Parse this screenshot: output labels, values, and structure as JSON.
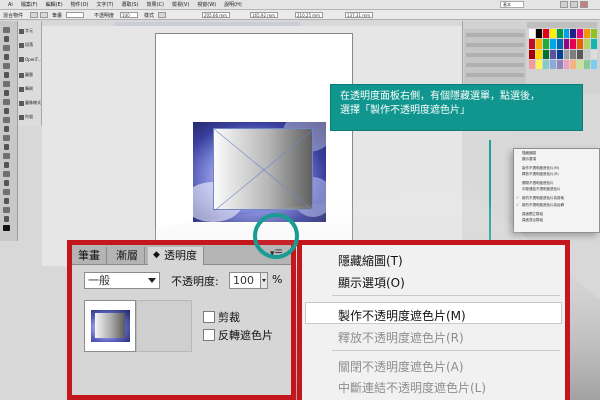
{
  "menubar": {
    "items": [
      "Ai",
      "檔案(F)",
      "編輯(E)",
      "物件(O)",
      "文字(T)",
      "選取(S)",
      "效果(C)",
      "檢視(V)",
      "視窗(W)",
      "說明(H)"
    ],
    "workspace": "基本"
  },
  "ctrlbar": {
    "selection_label": "混合物件",
    "stroke_label": "筆畫",
    "opacity_label": "不透明度",
    "opacity_value": "100",
    "style_label": "樣式",
    "x_value": "205.66 mm",
    "y_value": "165.92 mm",
    "w_value": "210.25 mm",
    "h_value": "137.31 mm"
  },
  "left_panel": {
    "items": [
      "字元",
      "段落",
      "OpenT...",
      "圖層",
      "筆刷",
      "圖像樣式",
      "符號"
    ]
  },
  "callout": {
    "line1": "在透明度面板右側，有個隱藏選單，點選後，",
    "line2": "選擇「製作不透明度遮色片」"
  },
  "mini_menu": {
    "items": [
      "隱藏縮圖",
      "顯示選項",
      "製作不透明度遮色片(M)",
      "釋放不透明度遮色片(R)",
      "關閉不透明度遮色片",
      "中斷連結不透明度遮色片",
      "新的不透明度遮色片為剪裁",
      "新的不透明度遮色片為反轉",
      "頁面獨立群組",
      "頁面混合群組"
    ]
  },
  "transparency_panel": {
    "tabs": [
      "筆畫",
      "漸層",
      "透明度"
    ],
    "blend_mode": "一般",
    "opacity_label": "不透明度:",
    "opacity_value": "100",
    "opacity_unit": "%",
    "clip_label": "剪裁",
    "invert_label": "反轉遮色片",
    "menu_icon": "panel-menu-icon"
  },
  "flyout_menu": {
    "items": [
      {
        "label": "隱藏縮圖(T)",
        "enabled": true
      },
      {
        "label": "顯示選項(O)",
        "enabled": true
      },
      {
        "label": "製作不透明度遮色片(M)",
        "enabled": true
      },
      {
        "label": "釋放不透明度遮色片(R)",
        "enabled": false
      },
      {
        "label": "關閉不透明度遮色片(A)",
        "enabled": false
      },
      {
        "label": "中斷連結不透明度遮色片(L)",
        "enabled": false
      }
    ]
  },
  "colors": {
    "callout": "#10968f",
    "highlight_border": "#c4171c",
    "ring": "#1a9b93"
  }
}
